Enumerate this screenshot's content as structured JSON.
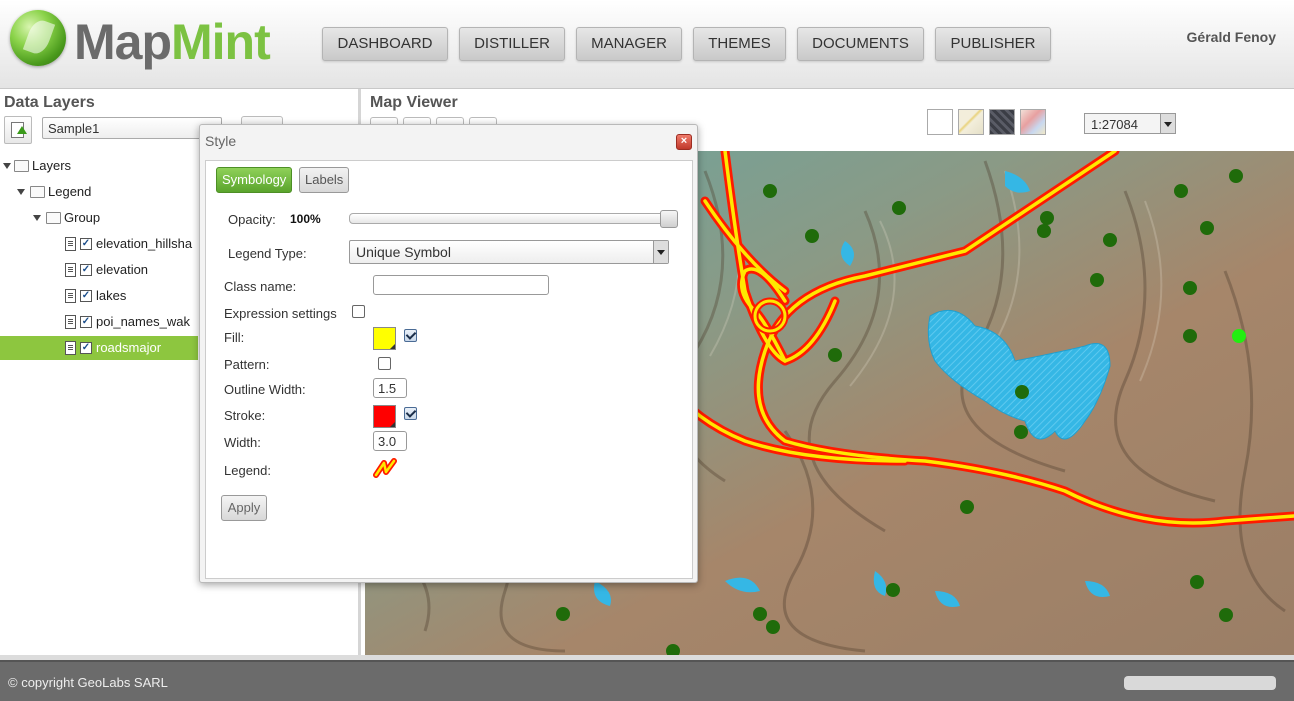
{
  "header": {
    "brand_part1": "Map",
    "brand_part2": "Mint",
    "nav": [
      "DASHBOARD",
      "DISTILLER",
      "MANAGER",
      "THEMES",
      "DOCUMENTS",
      "PUBLISHER"
    ],
    "user": "Gérald Fenoy"
  },
  "left_panel": {
    "title": "Data Layers",
    "map_select_value": "Sample1",
    "tree": {
      "root": "Layers",
      "legend": "Legend",
      "group": "Group",
      "layers": [
        "elevation_hillsha",
        "elevation",
        "lakes",
        "poi_names_wak",
        "roadsmajor"
      ],
      "selected": "roadsmajor"
    }
  },
  "map_viewer": {
    "title": "Map Viewer",
    "scale": "1:27084",
    "background_tiles": [
      "blank",
      "roads",
      "satellite",
      "osm"
    ],
    "colors": {
      "road_outer": "#ff1a00",
      "road_inner": "#ffe800",
      "lake": "#2fb6e4",
      "poi": "#1f6b0a",
      "poi_highlight": "#22ee11"
    }
  },
  "style_dialog": {
    "title": "Style",
    "close_label": "×",
    "tabs": {
      "symbology": "Symbology",
      "labels": "Labels"
    },
    "opacity_label": "Opacity:",
    "opacity_value": "100%",
    "opacity_level": 1.0,
    "legend_type_label": "Legend Type:",
    "legend_type_value": "Unique Symbol",
    "class_name_label": "Class name:",
    "class_name_value": "",
    "expression_label": "Expression settings",
    "fill_label": "Fill:",
    "fill_color": "#ffff00",
    "pattern_label": "Pattern:",
    "outline_width_label": "Outline Width:",
    "outline_width_value": "1.5",
    "stroke_label": "Stroke:",
    "stroke_color": "#ff0000",
    "width_label": "Width:",
    "width_value": "3.0",
    "legend_label": "Legend:",
    "apply_label": "Apply"
  },
  "footer": {
    "copyright": "© copyright GeoLabs SARL"
  }
}
